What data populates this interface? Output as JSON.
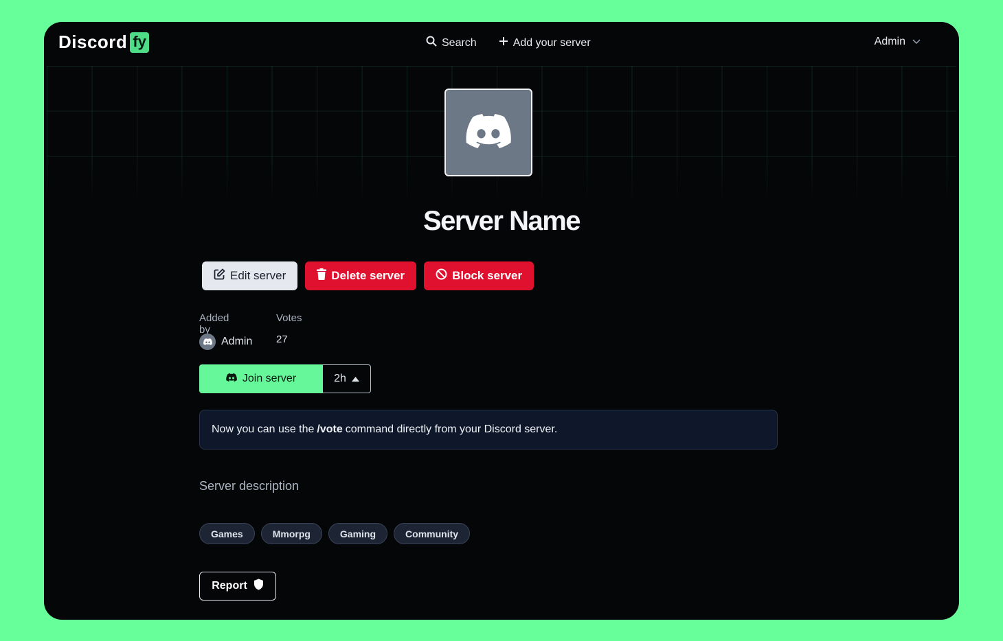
{
  "header": {
    "logo_text": "Discord",
    "logo_badge": "fy",
    "nav": {
      "search": "Search",
      "add_server": "Add your server"
    },
    "user_label": "Admin"
  },
  "server": {
    "name": "Server Name",
    "actions": {
      "edit": "Edit server",
      "delete": "Delete server",
      "block": "Block server"
    },
    "meta": {
      "added_by_label": "Added by",
      "added_by_value": "Admin",
      "votes_label": "Votes",
      "votes_value": "27"
    },
    "join_label": "Join server",
    "vote_timer": "2h",
    "notice": {
      "before": "Now you can use the",
      "command": "/vote",
      "after": "command directly from your Discord server."
    },
    "description_label": "Server description",
    "tags": [
      "Games",
      "Mmorpg",
      "Gaming",
      "Community"
    ],
    "report_label": "Report"
  },
  "colors": {
    "page_bg": "#66ff99",
    "window_bg": "#050608",
    "accent_green": "#66f79a",
    "danger_red": "#e0102f",
    "notice_bg": "#0f182a"
  },
  "icons": {
    "search": "search-icon",
    "add": "plus-icon",
    "user_menu": "chevron-down-icon",
    "server_avatar": "discord-logo-icon",
    "edit": "edit-icon",
    "delete": "trash-icon",
    "block": "ban-icon",
    "join": "discord-icon",
    "timer": "caret-up-icon",
    "report": "shield-icon"
  }
}
